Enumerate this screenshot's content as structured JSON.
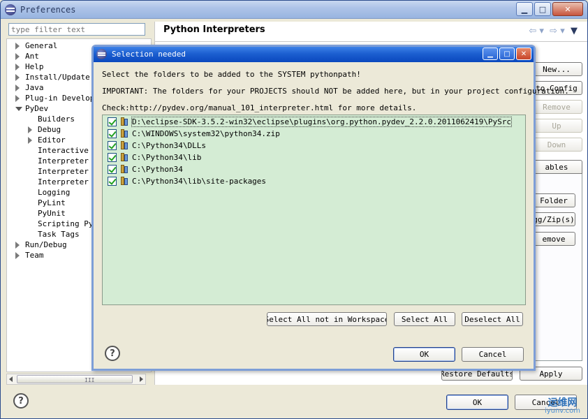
{
  "window": {
    "title": "Preferences"
  },
  "filter": {
    "placeholder": "type filter text"
  },
  "tree": [
    {
      "label": "General",
      "expander": "closed"
    },
    {
      "label": "Ant",
      "expander": "closed"
    },
    {
      "label": "Help",
      "expander": "closed"
    },
    {
      "label": "Install/Update",
      "expander": "closed"
    },
    {
      "label": "Java",
      "expander": "closed"
    },
    {
      "label": "Plug-in Develop",
      "expander": "closed"
    },
    {
      "label": "PyDev",
      "expander": "open"
    },
    {
      "label": "Builders",
      "expander": "none"
    },
    {
      "label": "Debug",
      "expander": "closed"
    },
    {
      "label": "Editor",
      "expander": "closed"
    },
    {
      "label": "Interactive C",
      "expander": "none"
    },
    {
      "label": "Interpreter -",
      "expander": "none"
    },
    {
      "label": "Interpreter -",
      "expander": "none"
    },
    {
      "label": "Interpreter -",
      "expander": "none"
    },
    {
      "label": "Logging",
      "expander": "none"
    },
    {
      "label": "PyLint",
      "expander": "none"
    },
    {
      "label": "PyUnit",
      "expander": "none"
    },
    {
      "label": "Scripting PyD",
      "expander": "none"
    },
    {
      "label": "Task Tags",
      "expander": "none"
    },
    {
      "label": "Run/Debug",
      "expander": "closed"
    },
    {
      "label": "Team",
      "expander": "closed"
    }
  ],
  "scrollbar": {
    "grip": "III"
  },
  "page": {
    "title": "Python Interpreters",
    "nav_back": "⇦ ▾",
    "nav_fwd": "⇨ ▾",
    "nav_menu": "▼",
    "buttons": {
      "new": "New...",
      "auto_config": "to Config",
      "remove": "Remove",
      "up": "Up",
      "down": "Down",
      "tab_variables": "ables",
      "new_folder": "Folder",
      "new_egg": "gg/Zip(s)",
      "remove_lib": "emove"
    },
    "restore_defaults": "Restore Defaults",
    "apply": "Apply"
  },
  "footer": {
    "ok": "OK",
    "cancel": "Cancel"
  },
  "dialog": {
    "title": "Selection needed",
    "line1": "Select the folders to be added to the SYSTEM pythonpath!",
    "line2": "IMPORTANT: The folders for your PROJECTS should NOT be added here, but in your project configuration.",
    "line3": "Check:http://pydev.org/manual_101_interpreter.html for more details.",
    "items": [
      "D:\\eclipse-SDK-3.5.2-win32\\eclipse\\plugins\\org.python.pydev_2.2.0.2011062419\\PySrc",
      "C:\\WINDOWS\\system32\\python34.zip",
      "C:\\Python34\\DLLs",
      "C:\\Python34\\lib",
      "C:\\Python34",
      "C:\\Python34\\lib\\site-packages"
    ],
    "select_not_workspace": "Select All not in Workspace",
    "select_all": "Select All",
    "deselect_all": "Deselect All",
    "ok": "OK",
    "cancel": "Cancel",
    "help": "?"
  },
  "help_icon": "?",
  "watermark": {
    "line1": "运维网",
    "line2": "iyunv.com"
  },
  "colors": {
    "list_bg": "#d4ecd4",
    "dialog_title": "#0a48be",
    "window_bg": "#ece9d8"
  }
}
